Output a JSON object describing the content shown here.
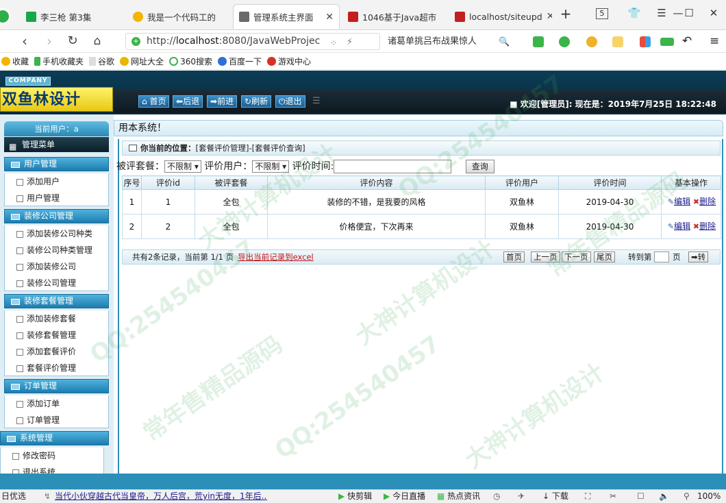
{
  "browser": {
    "tabs": [
      {
        "title": "李三枪 第3集",
        "color": "#1aa74a"
      },
      {
        "title": "我是一个代码工的",
        "color": "#f5b400"
      },
      {
        "title": "管理系统主界面",
        "color": "#6a6a6a"
      },
      {
        "title": "1046基于Java超市",
        "color": "#c21f1f"
      },
      {
        "title": "localhost/siteupd",
        "color": "#c21f1f"
      }
    ],
    "tab_count": "5",
    "url_prefix": "http://",
    "url_host": "localhost",
    "url_rest": ":8080/JavaWebProjec",
    "search_suggest": "诸葛单挑吕布战果惊人",
    "bookmarks": [
      "收藏",
      "手机收藏夹",
      "谷歌",
      "网址大全",
      "360搜索",
      "百度一下",
      "游戏中心"
    ]
  },
  "header": {
    "company": "COMPANY",
    "logo": "双鱼林设计",
    "buttons": [
      "首页",
      "后退",
      "前进",
      "刷新",
      "退出"
    ],
    "welcome": "■ 欢迎[管理员]:  现在是：2019年7月25日 18:22:48"
  },
  "sidebar": {
    "user": "当前用户：a",
    "menu_title": "管理菜单",
    "groups": [
      {
        "label": "用户管理",
        "items": [
          "添加用户",
          "用户管理"
        ]
      },
      {
        "label": "装修公司管理",
        "items": [
          "添加装修公司种类",
          "装修公司种类管理",
          "添加装修公司",
          "装修公司管理"
        ]
      },
      {
        "label": "装修套餐管理",
        "items": [
          "添加装修套餐",
          "装修套餐管理",
          "添加套餐评价",
          "套餐评价管理"
        ]
      },
      {
        "label": "订单管理",
        "items": [
          "添加订单",
          "订单管理"
        ]
      },
      {
        "label": "系统管理",
        "items": [
          "修改密码",
          "退出系统"
        ]
      }
    ]
  },
  "content": {
    "title": "用本系统！",
    "breadcrumb_label": "你当前的位置：",
    "breadcrumb_path": "[套餐评价管理]-[套餐评价查询]",
    "filters": {
      "package_label": "被评套餐：",
      "package_value": "不限制",
      "user_label": "评价用户：",
      "user_value": "不限制",
      "time_label": "评价时间:",
      "time_value": "",
      "query_button": "查询"
    },
    "table": {
      "headers": [
        "序号",
        "评价id",
        "被评套餐",
        "评价内容",
        "评价用户",
        "评价时间",
        "基本操作"
      ],
      "rows": [
        {
          "no": "1",
          "id": "1",
          "package": "全包",
          "content": "装修的不错，是我要的风格",
          "user": "双鱼林",
          "time": "2019-04-30",
          "edit": "编辑",
          "delete": "删除"
        },
        {
          "no": "2",
          "id": "2",
          "package": "全包",
          "content": "价格便宜，下次再来",
          "user": "双鱼林",
          "time": "2019-04-30",
          "edit": "编辑",
          "delete": "删除"
        }
      ]
    },
    "pager": {
      "summary": "共有2条记录，当前第 1/1 页",
      "export": "导出当前记录到excel",
      "first": "首页",
      "prev": "上一页",
      "next": "下一页",
      "last": "尾页",
      "goto_label": "转到第",
      "goto_value": "",
      "page_unit": "页",
      "go": "转"
    }
  },
  "statusbar": {
    "left": "日优选",
    "news": "当代小伙穿越古代当皇帝，万人后宫，荒yin无度，1年后...",
    "items": [
      "快剪辑",
      "今日直播",
      "热点资讯",
      "下载"
    ],
    "zoom": "100%"
  },
  "watermark": [
    "常年售精品源码",
    "QQ:254540457",
    "大神计算机设计"
  ]
}
